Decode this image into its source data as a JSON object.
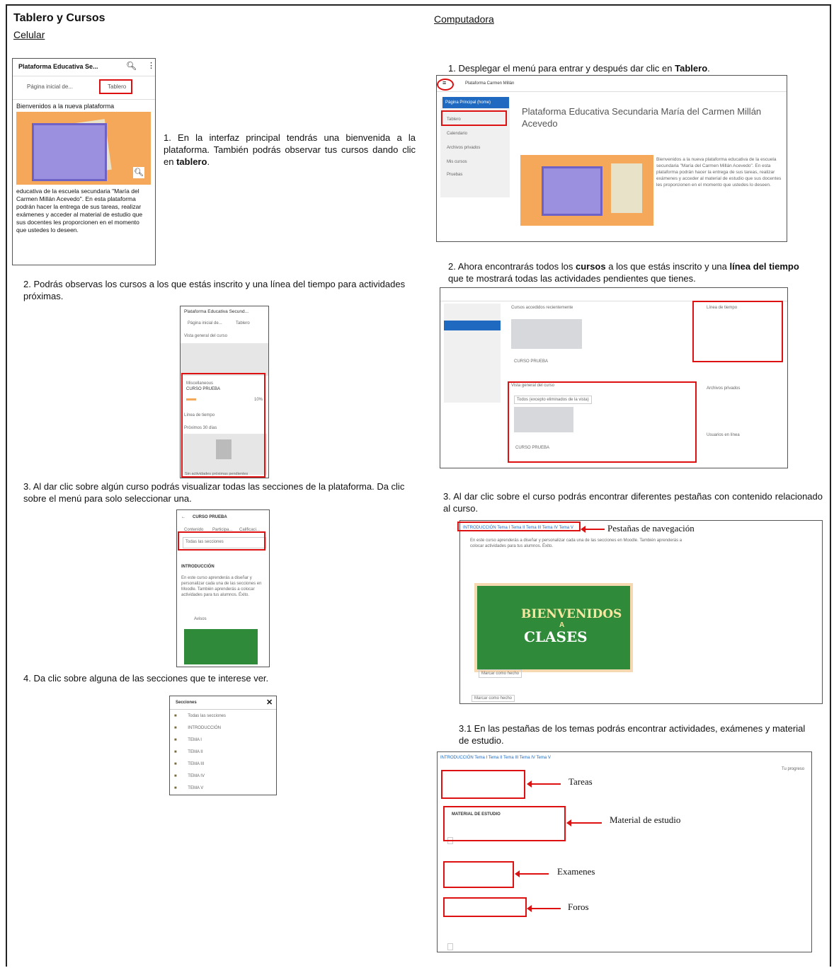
{
  "left": {
    "title": "Tablero y Cursos",
    "subtitle": "Celular",
    "phone1": {
      "app_title": "Plataforma Educativa Se...",
      "tab_home": "Página inicial de...",
      "tab_board": "Tablero",
      "welcome": "Bienvenidos a la nueva plataforma",
      "body": "educativa de la escuela secundaria \"María del Carmen Millán Acevedo\". En esta plataforma podrán hacer la entrega de sus tareas, realizar exámenes y acceder al material de estudio que sus docentes les proporcionen en el momento que ustedes lo deseen."
    },
    "step1": "1. En la interfaz principal tendrás una bienvenida a la plataforma. También podrás observar tus cursos dando clic en",
    "step1_bold": "tablero",
    "step2": "2. Podrás observas los cursos a los que estás inscrito y una línea del tiempo para actividades próximas.",
    "phone2": {
      "app_title": "Plataforma Educativa Secund...",
      "tab_home": "Página inicial de...",
      "tab_board": "Tablero",
      "overview": "Vista general del curso",
      "category": "Miscellaneous",
      "course": "CURSO PRUEBA",
      "progress": "10%",
      "timeline": "Línea de tiempo",
      "next30": "Próximos 30 días",
      "no_activities": "Sin actividades próximas pendientes"
    },
    "step3": "3. Al dar clic sobre algún curso podrás visualizar todas las secciones de la plataforma. Da clic sobre el menú para solo seleccionar una.",
    "phone3": {
      "course_title": "CURSO PRUEBA",
      "tabs": [
        "Contenido",
        "Participa...",
        "Calificaci..."
      ],
      "select": "Todas las secciones",
      "intro": "INTRODUCCIÓN",
      "text": "En este curso aprenderás a diseñar y personalizar cada una de las secciones en Moodle. También aprenderás a colocar actividades para tus alumnos. Éxito.",
      "avisos": "Avisos"
    },
    "step4": "4. Da clic sobre alguna de las secciones que te interese ver.",
    "sections": {
      "title": "Secciones",
      "items": [
        "Todas las secciones",
        "INTRODUCCIÓN",
        "TEMA I",
        "TEMA II",
        "TEMA III",
        "TEMA IV",
        "TEMA V"
      ]
    }
  },
  "right": {
    "subtitle": "Computadora",
    "step1_pre": "1. Desplegar el menú para entrar y después dar clic en",
    "step1_bold": "Tablero",
    "desk1": {
      "brand": "Plataforma Carmen Millán",
      "heading": "Plataforma Educativa Secundaria María del Carmen Millán Acevedo",
      "nav": [
        "Página Principal (home)",
        "Tablero",
        "Calendario",
        "Archivos privados",
        "Mis cursos",
        "Pruebas"
      ],
      "welcome": "Bienvenidos a la nueva plataforma educativa de la escuela secundaria \"María del Carmen Millán Acevedo\". En esta plataforma podrán hacer la entrega de sus tareas, realizar exámenes y acceder al material de estudio que sus docentes les proporcionen en el momento que ustedes lo deseen."
    },
    "step2_a": "2. Ahora encontrarás todos los",
    "step2_b": "cursos",
    "step2_c": "a los que estás inscrito y una",
    "step2_d": "línea del tiempo",
    "step2_e": "que te mostrará todas las actividades pendientes que tienes.",
    "desk2": {
      "recent": "Cursos accedidos recientemente",
      "course": "CURSO PRUEBA",
      "overview": "Vista general del curso",
      "filter": "Todos (excepto eliminados de la vista)",
      "timeline": "Línea de tiempo",
      "private": "Archivos privados",
      "online": "Usuarios en línea"
    },
    "step3": "3. Al dar clic sobre el curso podrás encontrar diferentes pestañas con contenido relacionado al curso.",
    "nav_label": "Pestañas de navegación",
    "desk3": {
      "tabs": "INTRODUCCIÓN  Tema I  Tema II  Tema III  Tema IV  Tema V",
      "text": "En este curso aprenderás a diseñar y personalizar cada una de las secciones en Moodle. También aprenderás a colocar actividades para tus alumnos. Éxito.",
      "banner_top": "BIENVENIDOS",
      "banner_mid": "A",
      "banner_bottom": "CLASES",
      "mark": "Marcar como hecho"
    },
    "step31": "3.1 En las pestañas de los temas podrás encontrar actividades, exámenes y material de estudio.",
    "labels": {
      "tareas": "Tareas",
      "material": "Material de estudio",
      "examenes": "Examenes",
      "foros": "Foros"
    },
    "desk4": {
      "tabs": "INTRODUCCIÓN  Tema I  Tema II  Tema III  Tema IV  Tema V",
      "material": "MATERIAL DE ESTUDIO",
      "progress": "Tu progreso"
    }
  }
}
